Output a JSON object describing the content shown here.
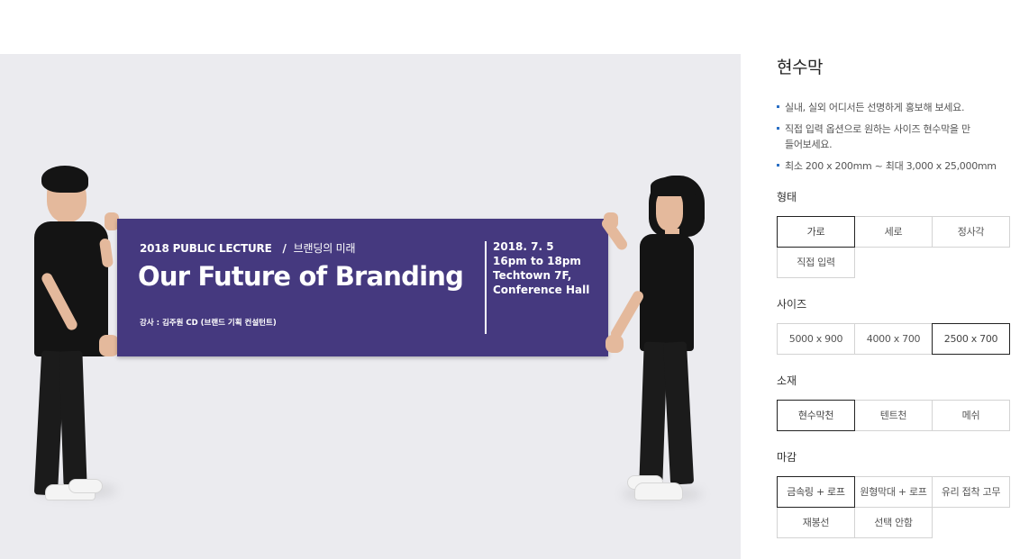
{
  "banner": {
    "kicker": "2018 PUBLIC LECTURE",
    "kicker_sep": "/",
    "kicker_sub": "브랜딩의 미래",
    "title": "Our Future of Branding",
    "speaker": "강사 : 김주원 CD (브랜드 기획 컨설턴트)",
    "date": "2018. 7. 5",
    "time": "16pm to 18pm",
    "venue_1": "Techtown 7F,",
    "venue_2": "Conference Hall",
    "color": "#45397f"
  },
  "product": {
    "title": "현수막",
    "features": [
      "실내, 실외 어디서든 선명하게 홍보해 보세요.",
      "직접 입력 옵션으로 원하는 사이즈 현수막을 만들어보세요.",
      "최소 200 x 200mm ~ 최대 3,000 x 25,000mm"
    ]
  },
  "options": {
    "shape": {
      "label": "형태",
      "items": [
        "가로",
        "세로",
        "정사각",
        "직접 입력"
      ],
      "selected": "가로"
    },
    "size": {
      "label": "사이즈",
      "items": [
        "5000 x 900",
        "4000 x 700",
        "2500 x 700"
      ],
      "selected": "2500 x 700"
    },
    "material": {
      "label": "소재",
      "items": [
        "현수막천",
        "텐트천",
        "메쉬"
      ],
      "selected": "현수막천"
    },
    "finish": {
      "label": "마감",
      "items": [
        "금속링 + 로프",
        "원형막대 + 로프",
        "유리 접착 고무",
        "재봉선",
        "선택 안함"
      ],
      "selected": "금속링 + 로프"
    }
  },
  "colors": {
    "accent_bullet": "#2a6fc4",
    "selected_border": "#222222",
    "photo_bg": "#ebebef"
  }
}
